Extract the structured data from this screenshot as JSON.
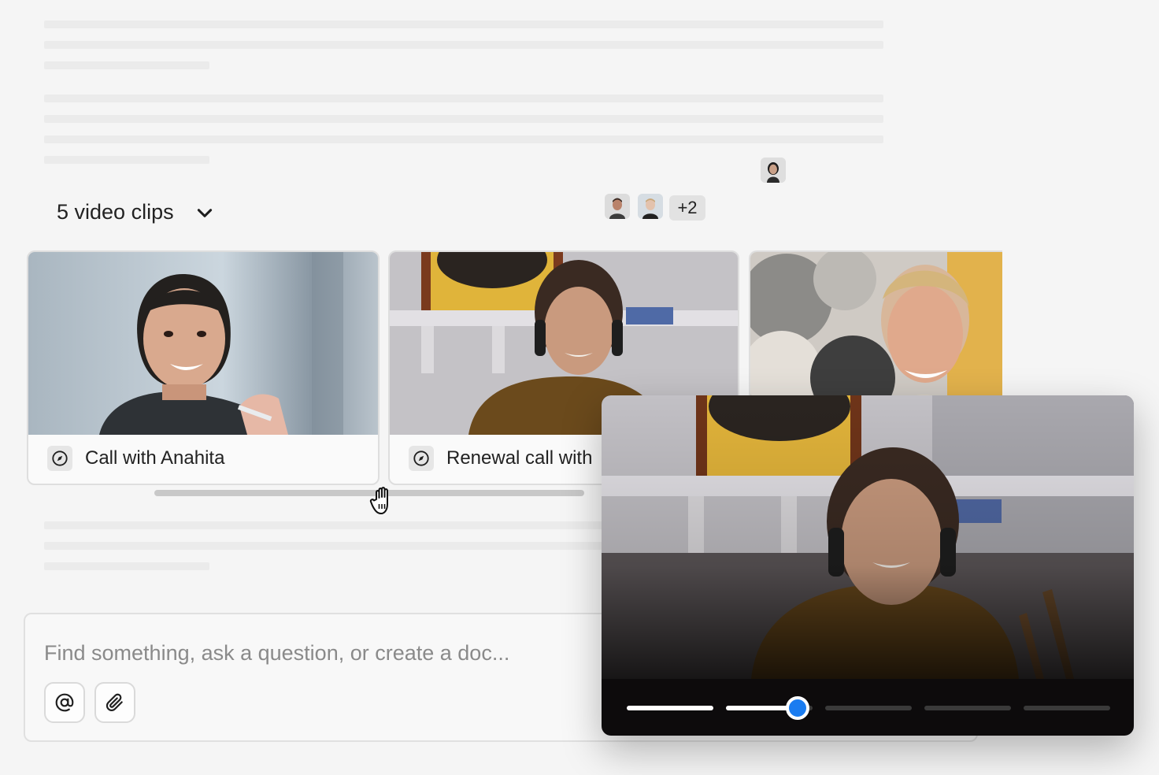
{
  "clips": {
    "count_label": "5 video clips",
    "participants_extra": "+2",
    "cards": [
      {
        "title": "Call with Anahita"
      },
      {
        "title": "Renewal call with"
      }
    ]
  },
  "composer": {
    "placeholder": "Find something, ask a question, or create a doc..."
  },
  "player": {
    "segments_total": 5,
    "active_segment": 2,
    "active_segment_progress": 0.8
  },
  "colors": {
    "accent": "#1a7cf0",
    "background": "#f5f5f5"
  },
  "icons": {
    "expand": "chevron-down-icon",
    "clip": "compass-icon",
    "mention": "at-sign-icon",
    "attach": "paperclip-icon",
    "cursor": "hand-grab-cursor-icon"
  }
}
